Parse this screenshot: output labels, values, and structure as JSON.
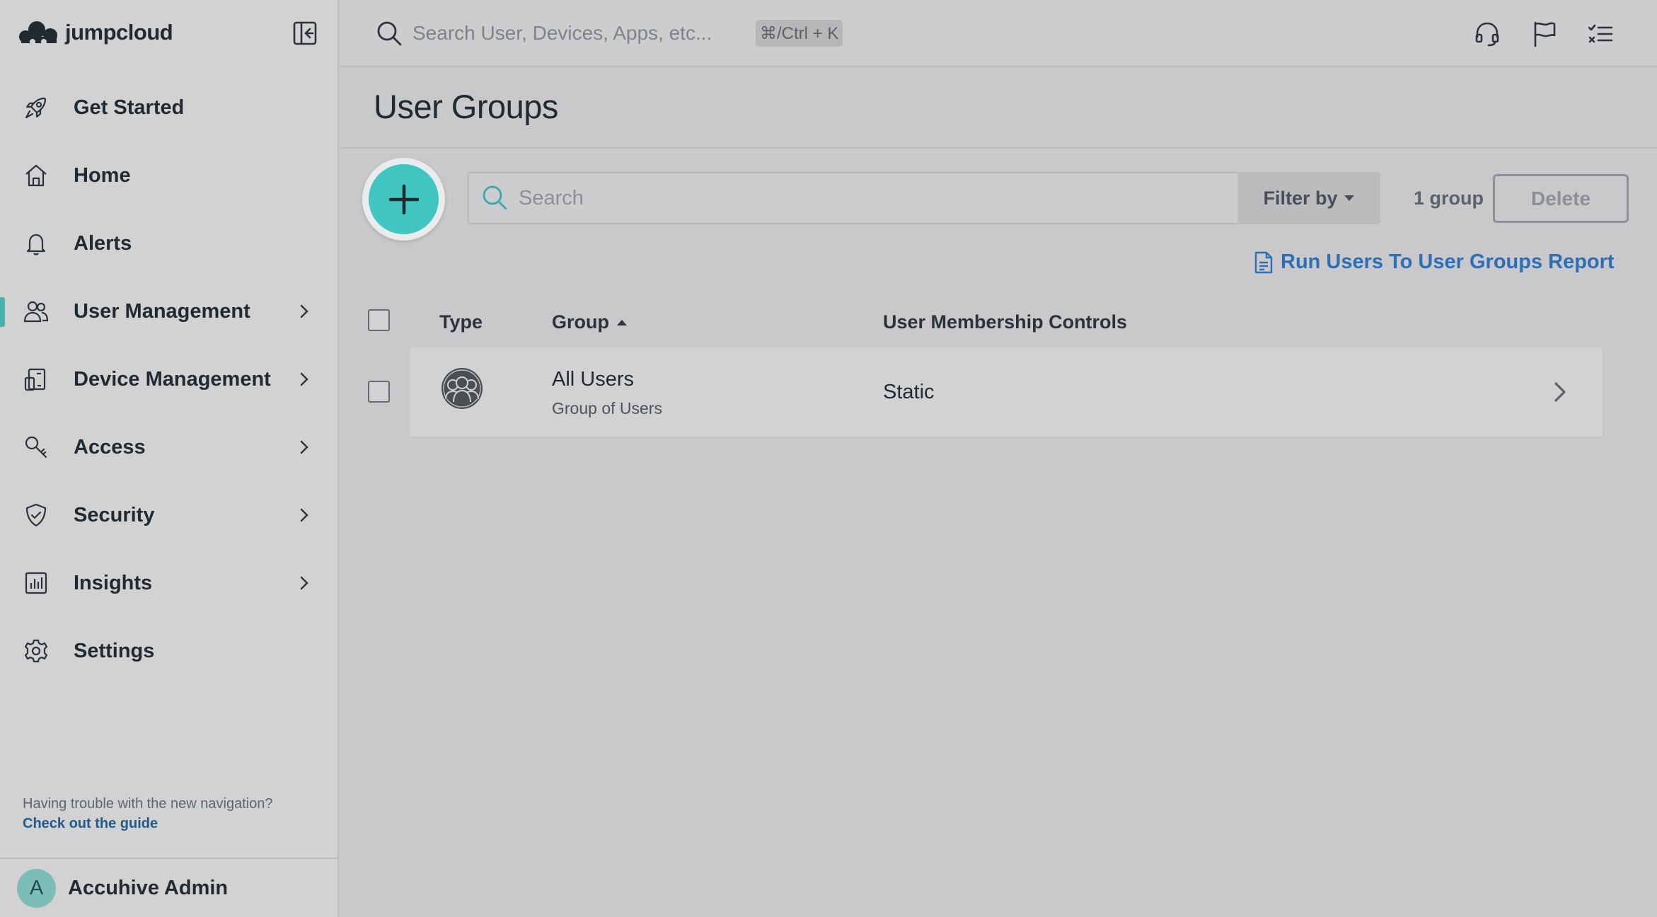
{
  "sidebar": {
    "logo_text": "jumpcloud",
    "nav": [
      {
        "label": "Get Started"
      },
      {
        "label": "Home"
      },
      {
        "label": "Alerts"
      },
      {
        "label": "User Management"
      },
      {
        "label": "Device Management"
      },
      {
        "label": "Access"
      },
      {
        "label": "Security"
      },
      {
        "label": "Insights"
      },
      {
        "label": "Settings"
      }
    ],
    "help_text": "Having trouble with the new navigation?",
    "help_link": "Check out the guide",
    "user": {
      "initial": "A",
      "name": "Accuhive Admin"
    }
  },
  "topbar": {
    "search_placeholder": "Search User, Devices, Apps, etc...",
    "shortcut": "⌘/Ctrl + K",
    "icons": [
      "headset-icon",
      "flag-icon",
      "checklist-icon"
    ]
  },
  "page": {
    "title": "User Groups",
    "search_placeholder": "Search",
    "filter_label": "Filter by",
    "group_count": "1 group",
    "delete_label": "Delete",
    "report_link": "Run Users To User Groups Report"
  },
  "table": {
    "columns": [
      "Type",
      "Group",
      "User Membership Controls"
    ],
    "rows": [
      {
        "type_icon": "user-group-icon",
        "name": "All Users",
        "subtitle": "Group of Users",
        "membership": "Static"
      }
    ]
  },
  "colors": {
    "accent": "#40c5c1",
    "link": "#2f6db5",
    "active_indicator": "#46b2aa"
  }
}
